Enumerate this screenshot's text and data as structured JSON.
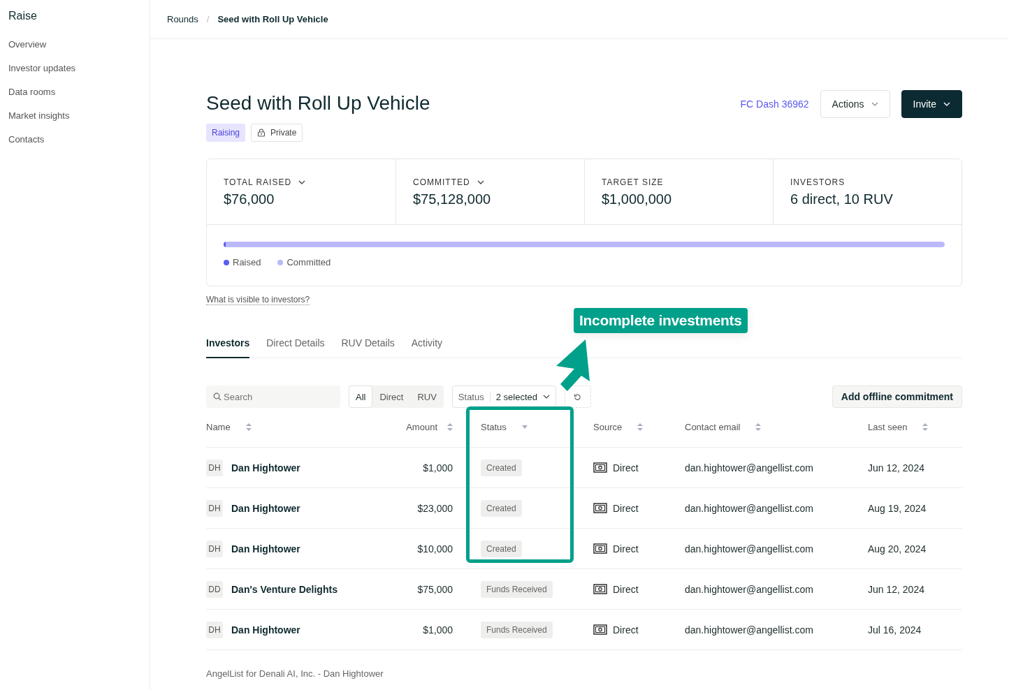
{
  "sidebar": {
    "brand": "Raise",
    "items": [
      {
        "label": "Overview",
        "selected": false
      },
      {
        "label": "Investor updates",
        "selected": false
      },
      {
        "label": "Data rooms",
        "selected": false
      },
      {
        "label": "Market insights",
        "selected": false
      },
      {
        "label": "Contacts",
        "selected": false
      }
    ]
  },
  "breadcrumb": [
    "Rounds",
    "Seed with Roll Up Vehicle"
  ],
  "breadcrumb_separator": "/",
  "header": {
    "title": "Seed with Roll Up Vehicle",
    "status_badge": "Raising",
    "privacy_badge": "Private",
    "link": "FC Dash 36962",
    "actions_button": "Actions",
    "invite_button": "Invite"
  },
  "stats": [
    {
      "label": "TOTAL RAISED",
      "value": "$76,000",
      "dropdown": true
    },
    {
      "label": "COMMITTED",
      "value": "$75,128,000",
      "dropdown": true
    },
    {
      "label": "TARGET SIZE",
      "value": "$1,000,000",
      "dropdown": false
    },
    {
      "label": "INVESTORS",
      "value": "6 direct, 10 RUV",
      "dropdown": false
    }
  ],
  "progress": {
    "raised": {
      "level": 0.003
    },
    "committed": {
      "level": 1
    },
    "legend": [
      {
        "label": "Raised",
        "color": "#5b5bf5"
      },
      {
        "label": "Committed",
        "color": "#b9b8f8"
      }
    ]
  },
  "visibility_link": "What is visible to investors?",
  "tabs": [
    {
      "label": "Investors",
      "selected": true
    },
    {
      "label": "Direct Details",
      "selected": false
    },
    {
      "label": "RUV Details",
      "selected": false
    },
    {
      "label": "Activity",
      "selected": false
    }
  ],
  "filters": {
    "search_placeholder": "Search",
    "segments": [
      {
        "label": "All",
        "selected": true
      },
      {
        "label": "Direct",
        "selected": false
      },
      {
        "label": "RUV",
        "selected": false
      }
    ],
    "status_label": "Status",
    "status_value": "2 selected",
    "add_button": "Add offline commitment"
  },
  "table": {
    "columns": [
      "Name",
      "Amount",
      "Status",
      "Source",
      "Contact email",
      "Last seen"
    ],
    "rows": [
      {
        "initials": "DH",
        "name": "Dan Hightower",
        "amount": "$1,000",
        "status": "Created",
        "source": "Direct",
        "email": "dan.hightower@angellist.com",
        "last_seen": "Jun 12, 2024"
      },
      {
        "initials": "DH",
        "name": "Dan Hightower",
        "amount": "$23,000",
        "status": "Created",
        "source": "Direct",
        "email": "dan.hightower@angellist.com",
        "last_seen": "Aug 19, 2024"
      },
      {
        "initials": "DH",
        "name": "Dan Hightower",
        "amount": "$10,000",
        "status": "Created",
        "source": "Direct",
        "email": "dan.hightower@angellist.com",
        "last_seen": "Aug 20, 2024"
      },
      {
        "initials": "DD",
        "name": "Dan's Venture Delights",
        "amount": "$75,000",
        "status": "Funds Received",
        "source": "Direct",
        "email": "dan.hightower@angellist.com",
        "last_seen": "Jun 12, 2024"
      },
      {
        "initials": "DH",
        "name": "Dan Hightower",
        "amount": "$1,000",
        "status": "Funds Received",
        "source": "Direct",
        "email": "dan.hightower@angellist.com",
        "last_seen": "Jul 16, 2024"
      }
    ]
  },
  "footer": "AngelList for Denali AI, Inc. - Dan Hightower",
  "annotation": {
    "callout": "Incomplete investments"
  }
}
